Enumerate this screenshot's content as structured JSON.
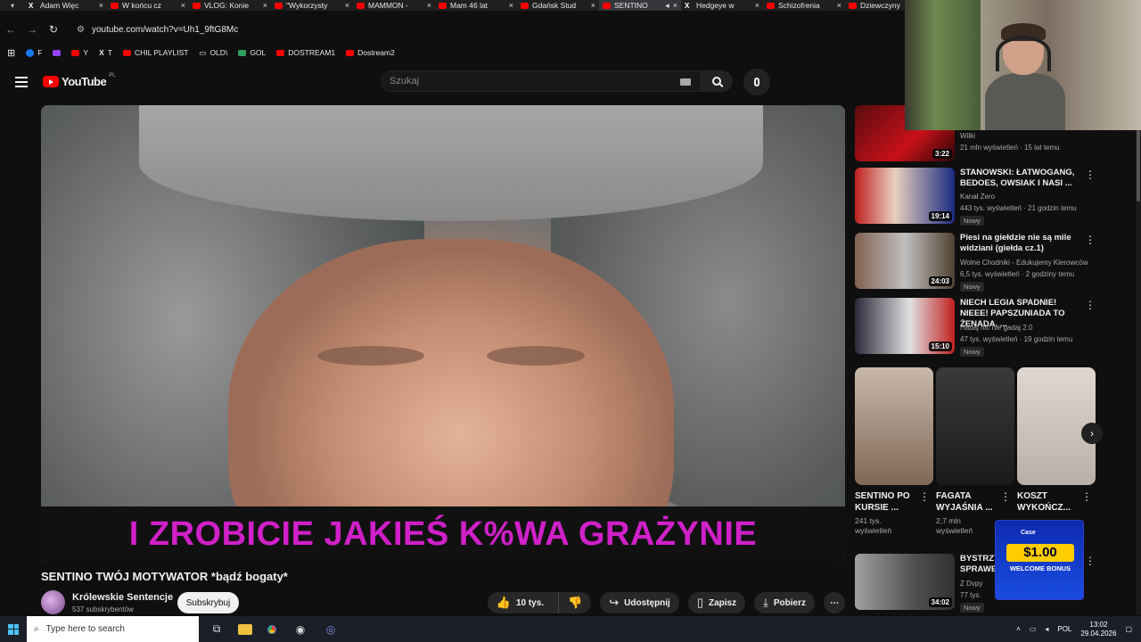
{
  "tabs": [
    {
      "title": "Adam Więc",
      "icon": "x-icon"
    },
    {
      "title": "W końcu cz",
      "icon": "youtube-icon"
    },
    {
      "title": "VLOG: Konie",
      "icon": "youtube-icon"
    },
    {
      "title": "\"Wykorzysty",
      "icon": "youtube-icon"
    },
    {
      "title": "MAMMON -",
      "icon": "youtube-icon"
    },
    {
      "title": "Mam 46 lat",
      "icon": "youtube-icon"
    },
    {
      "title": "Gdańsk Stud",
      "icon": "youtube-icon"
    },
    {
      "title": "SENTINO",
      "icon": "youtube-icon",
      "active": true
    },
    {
      "title": "Hedgeye w",
      "icon": "x-icon"
    },
    {
      "title": "Schizofrenia",
      "icon": "youtube-icon"
    },
    {
      "title": "Dziewczyny",
      "icon": "youtube-icon"
    }
  ],
  "address": {
    "url": "youtube.com/watch?v=Uh1_9ftG8Mc"
  },
  "bookmarks": [
    {
      "label": "F",
      "icon": "facebook-icon"
    },
    {
      "label": "",
      "icon": "twitch-icon"
    },
    {
      "label": "Y",
      "icon": "youtube-icon"
    },
    {
      "label": "T",
      "icon": "x-icon"
    },
    {
      "label": "CHIL PLAYLIST",
      "icon": "youtube-icon"
    },
    {
      "label": "OLD\\",
      "icon": "folder-icon"
    },
    {
      "label": "GOL",
      "icon": "gol-icon"
    },
    {
      "label": "DOSTREAM1",
      "icon": "youtube-icon"
    },
    {
      "label": "Dostream2",
      "icon": "youtube-icon"
    }
  ],
  "header": {
    "logo_text": "YouTube",
    "country": "PL",
    "search_placeholder": "Szukaj"
  },
  "video": {
    "subtitle": "I ZROBICIE JAKIEŚ K%WA GRAŻYNIE",
    "title": "SENTINO TWÓJ MOTYWATOR *bądź bogaty*",
    "channel": "Królewskie Sentencje",
    "subscribers": "537 subskrybentów",
    "subscribe_label": "Subskrybuj",
    "likes": "10 tys.",
    "share_label": "Udostępnij",
    "save_label": "Zapisz",
    "download_label": "Pobierz"
  },
  "recommendations": [
    {
      "title": "",
      "channel": "Wilki",
      "meta": "21 mln wyświetleń · 15 lat temu",
      "duration": "3:22",
      "badge": ""
    },
    {
      "title": "STANOWSKI: ŁATWOGANG, BEDOES, OWSIAK I NASI ...",
      "channel": "Kanał Zero",
      "meta": "443 tys. wyświetleń · 21 godzin temu",
      "duration": "19:14",
      "badge": "Nowy"
    },
    {
      "title": "Piesi na giełdzie nie są mile widziani (giełda cz.1)",
      "channel": "Wolne Chodniki - Edukujemy Kierowców",
      "meta": "6,5 tys. wyświetleń · 2 godziny temu",
      "duration": "24:03",
      "badge": "Nowy"
    },
    {
      "title": "NIECH LEGIA SPADNIE! NIEEE! PAPSZUNIADA TO ŻENADA. ...",
      "channel": "Hadaj nic nie gadaj 2.0",
      "meta": "47 tys. wyświetleń · 19 godzin temu",
      "duration": "15:10",
      "badge": "Nowy"
    },
    {
      "title": "BYSTRZY SPRAWE",
      "channel": "Z Dvpy",
      "meta": "77 tys.",
      "duration": "34:02",
      "badge": "Nowy"
    }
  ],
  "shorts": [
    {
      "title": "SENTINO PO KURSIE ...",
      "views": "241 tys. wyświetleń"
    },
    {
      "title": "FAGATA WYJAŚNIA ...",
      "views": "2,7 mln wyświetleń"
    },
    {
      "title": "KOSZT WYKOŃCZ...",
      "views": ""
    }
  ],
  "ad": {
    "brand": "Case",
    "price": "$1.00",
    "bonus": "WELCOME BONUS"
  },
  "taskbar": {
    "search_placeholder": "Type here to search",
    "language": "POL",
    "time": "13:02",
    "date": "29.04.2026"
  }
}
